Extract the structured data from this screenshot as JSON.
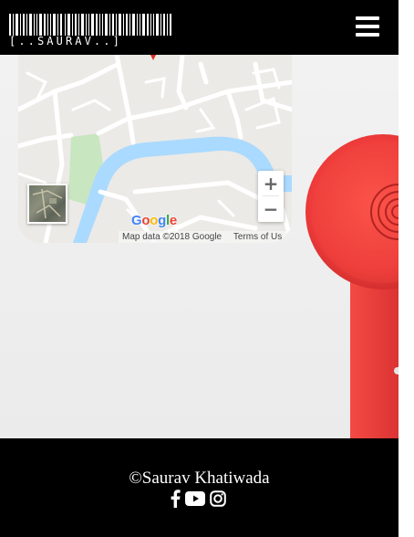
{
  "header": {
    "logo_text": "[..SAURAV..]",
    "menu_icon": "hamburger-menu-icon"
  },
  "map": {
    "google_logo": [
      "G",
      "o",
      "o",
      "g",
      "l",
      "e"
    ],
    "google_logo_colors": [
      "#4285F4",
      "#EA4335",
      "#FBBC05",
      "#4285F4",
      "#34A853",
      "#EA4335"
    ],
    "zoom_in": "+",
    "zoom_out": "−",
    "attribution": "Map data ©2018 Google",
    "terms": "Terms of Us",
    "satellite_icon": "satellite-thumbnail-icon",
    "water_color": "#aadaff",
    "park_color": "#c8e6c0",
    "road_color": "#ffffff"
  },
  "footer": {
    "copyright": "©Saurav Khatiwada",
    "social": [
      {
        "name": "facebook",
        "icon": "facebook-icon"
      },
      {
        "name": "youtube",
        "icon": "youtube-icon"
      },
      {
        "name": "instagram",
        "icon": "instagram-icon"
      }
    ]
  },
  "colors": {
    "header_bg": "#000000",
    "footer_bg": "#000000",
    "phone_red": "#ee3b3b"
  }
}
